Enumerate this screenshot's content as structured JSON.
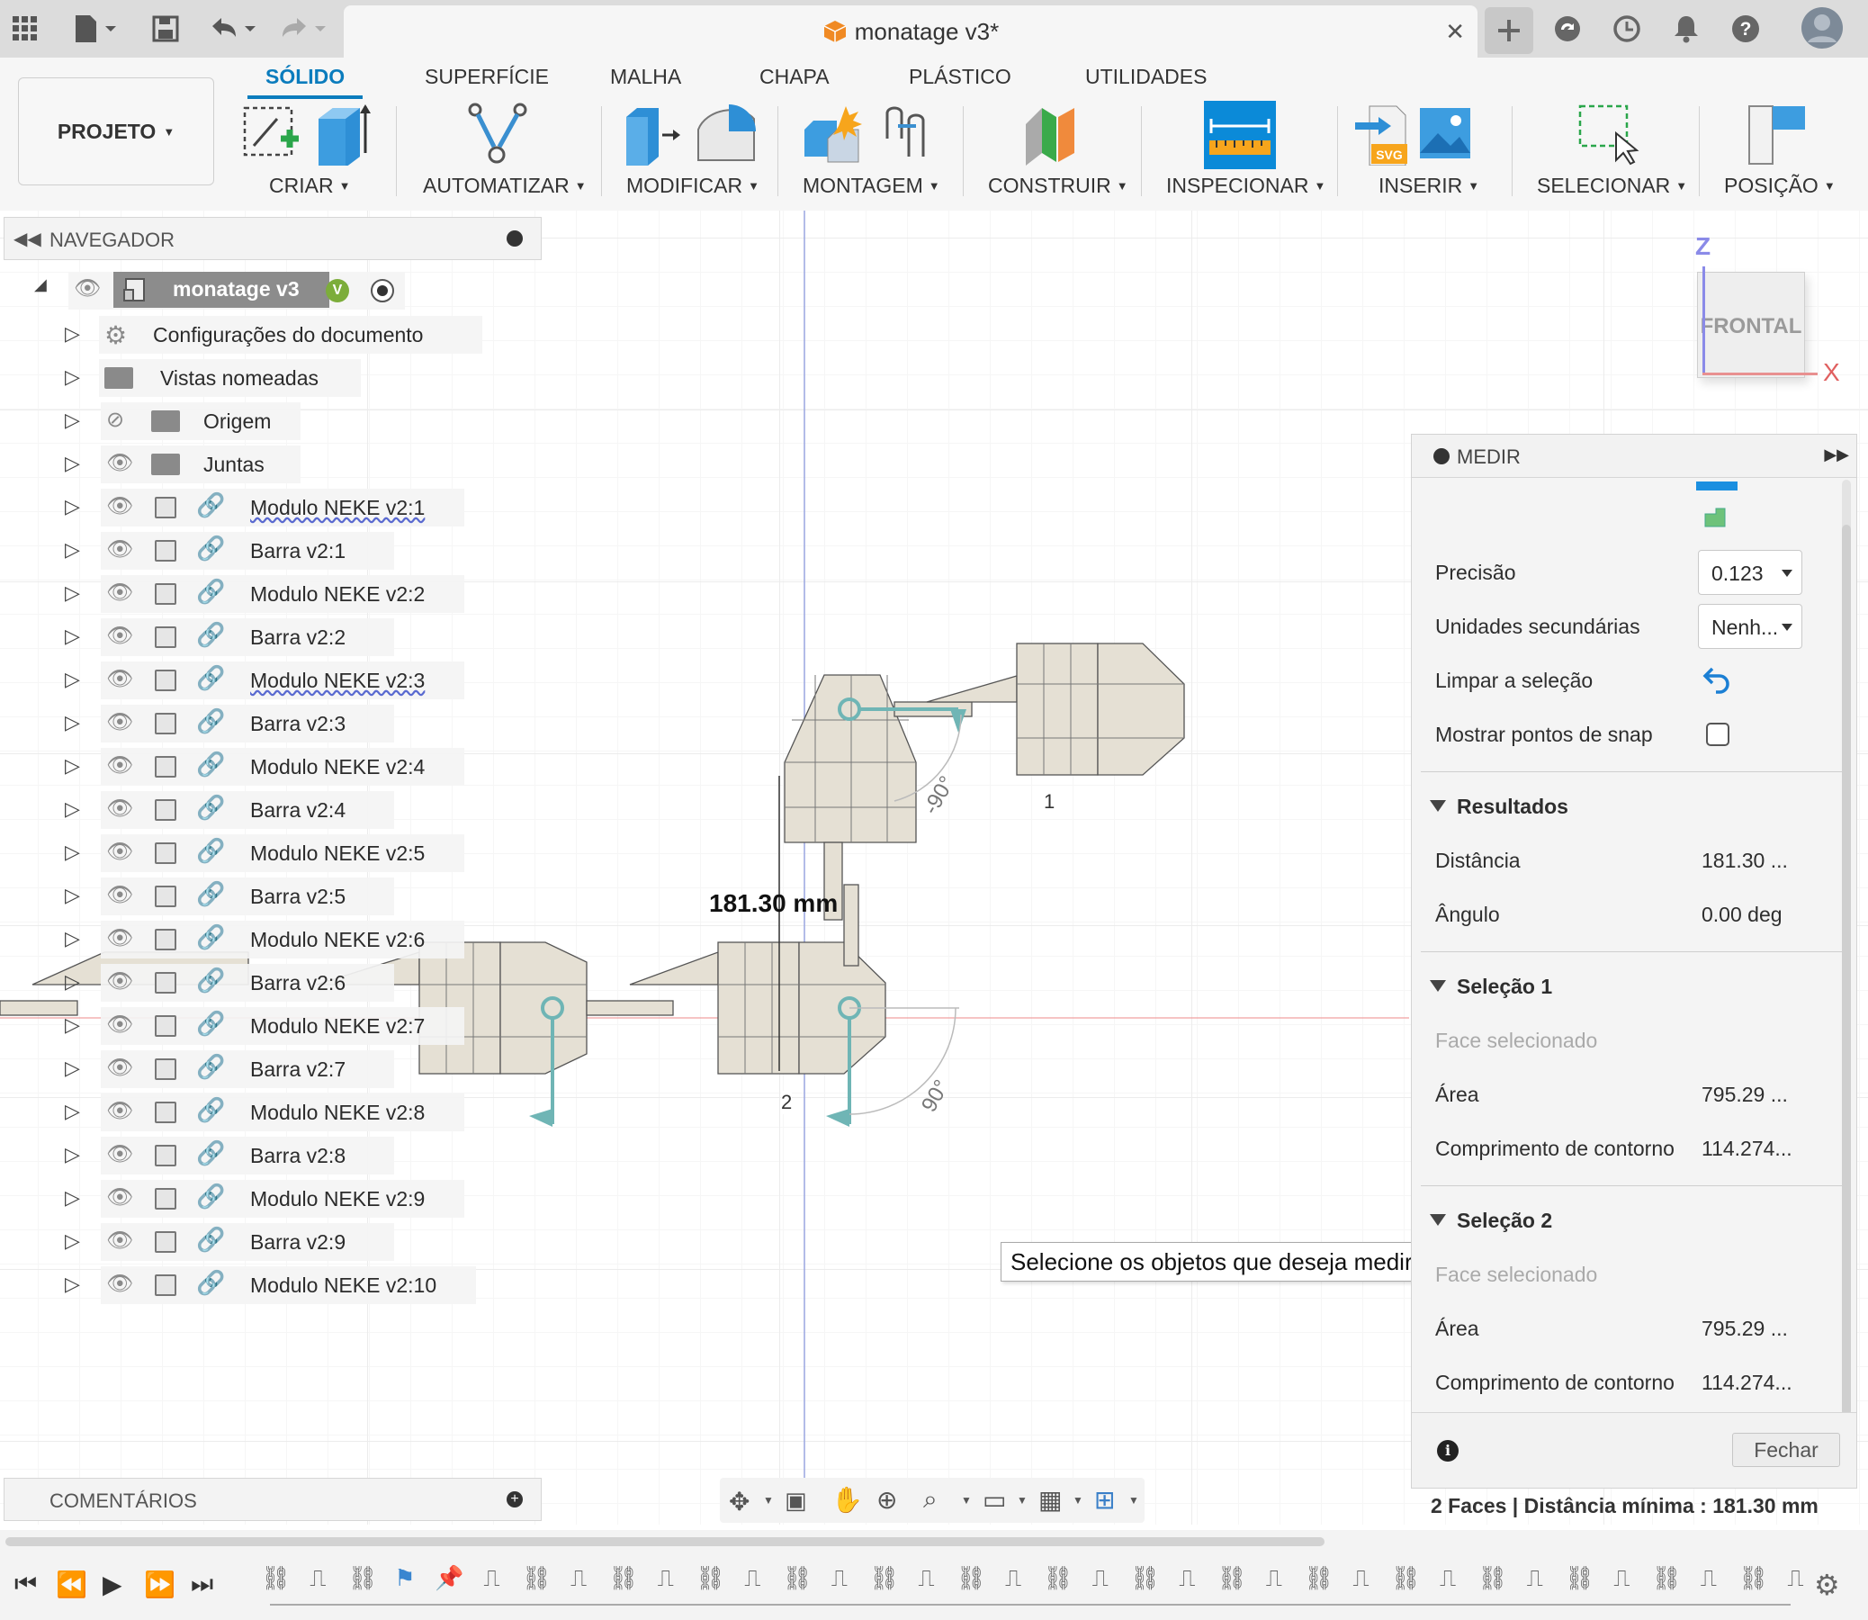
{
  "titlebar": {
    "document_title": "monatage v3*",
    "close_symbol": "✕",
    "icons": [
      "grid-icon",
      "file-icon",
      "save-icon",
      "undo-icon",
      "redo-icon",
      "new-tab-icon",
      "sync-icon",
      "history-icon",
      "bell-icon",
      "help-icon",
      "avatar"
    ]
  },
  "toolbar": {
    "project_label": "PROJETO",
    "tabs": [
      "SÓLIDO",
      "SUPERFÍCIE",
      "MALHA",
      "CHAPA",
      "PLÁSTICO",
      "UTILIDADES"
    ],
    "active_tab": "SÓLIDO",
    "groups": [
      "CRIAR",
      "AUTOMATIZAR",
      "MODIFICAR",
      "MONTAGEM",
      "CONSTRUIR",
      "INSPECIONAR",
      "INSERIR",
      "SELECIONAR",
      "POSIÇÃO"
    ],
    "accent_color": "#0b7cbd"
  },
  "browser": {
    "title": "NAVEGADOR",
    "root": "monatage v3",
    "items": [
      "Configurações do documento",
      "Vistas nomeadas",
      "Origem",
      "Juntas",
      "Modulo NEKE v2:1",
      "Barra v2:1",
      "Modulo NEKE v2:2",
      "Barra v2:2",
      "Modulo NEKE v2:3",
      "Barra v2:3",
      "Modulo NEKE v2:4",
      "Barra v2:4",
      "Modulo NEKE v2:5",
      "Barra v2:5",
      "Modulo NEKE v2:6",
      "Barra v2:6",
      "Modulo NEKE v2:7",
      "Barra v2:7",
      "Modulo NEKE v2:8",
      "Barra v2:8",
      "Modulo NEKE v2:9",
      "Barra v2:9",
      "Modulo NEKE v2:10"
    ]
  },
  "viewcube": {
    "face": "FRONTAL",
    "axis_z": "Z",
    "axis_x": "X"
  },
  "viewport": {
    "dimension_text": "181.30 mm",
    "angle_1": "-90°",
    "angle_2": "90°",
    "label_1": "1",
    "label_2": "2",
    "tooltip": "Selecione os objetos que deseja medir."
  },
  "measure": {
    "title": "MEDIR",
    "precision_label": "Precisão",
    "precision_value": "0.123",
    "secondary_units_label": "Unidades secundárias",
    "secondary_units_value": "Nenh...",
    "clear_selection_label": "Limpar a seleção",
    "show_snap_label": "Mostrar pontos de snap",
    "results_header": "Resultados",
    "distance_label": "Distância",
    "distance_value": "181.30 ...",
    "angle_label": "Ângulo",
    "angle_value": "0.00 deg",
    "sel1_header": "Seleção 1",
    "sel1_type": "Face selecionado",
    "sel1_area_label": "Área",
    "sel1_area_value": "795.29 ...",
    "sel1_perimeter_label": "Comprimento de contorno",
    "sel1_perimeter_value": "114.274...",
    "sel2_header": "Seleção 2",
    "sel2_type": "Face selecionado",
    "sel2_area_label": "Área",
    "sel2_area_value": "795.29 ...",
    "sel2_perimeter_label": "Comprimento de contorno",
    "sel2_perimeter_value": "114.274...",
    "close_button": "Fechar",
    "info_symbol": "i",
    "status_text": "2 Faces | Distância mínima : 181.30 mm"
  },
  "comments": {
    "title": "COMENTÁRIOS"
  }
}
